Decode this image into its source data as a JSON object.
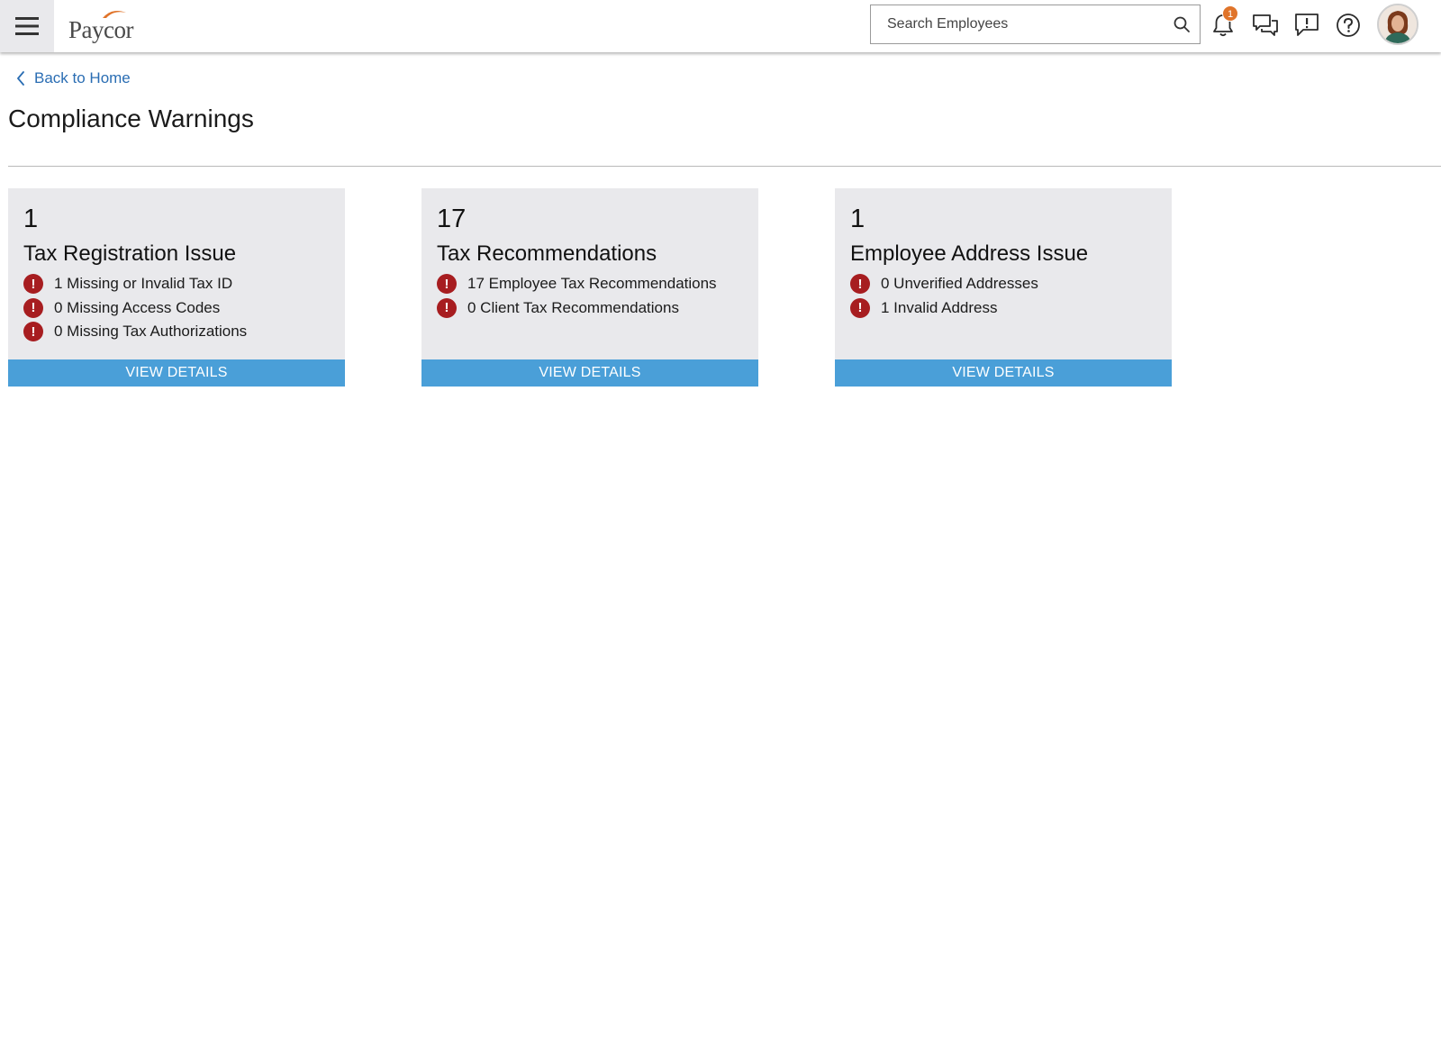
{
  "app": {
    "logo_text": "Paycor",
    "brand_color": "#e0742a",
    "accent_color": "#4a9fd8",
    "warning_color": "#a71d20"
  },
  "header": {
    "search_placeholder": "Search Employees",
    "notification_count": "1",
    "icons": [
      "menu-icon",
      "search-icon",
      "bell-icon",
      "chat-icon",
      "feedback-icon",
      "help-icon",
      "avatar"
    ]
  },
  "page": {
    "back_label": "Back to Home",
    "title": "Compliance Warnings"
  },
  "cards": [
    {
      "count": "1",
      "title": "Tax Registration Issue",
      "items": [
        "1 Missing or Invalid Tax ID",
        "0 Missing Access Codes",
        "0 Missing Tax Authorizations"
      ],
      "button_label": "VIEW DETAILS"
    },
    {
      "count": "17",
      "title": "Tax Recommendations",
      "items": [
        "17 Employee Tax Recommendations",
        "0 Client Tax Recommendations"
      ],
      "button_label": "VIEW DETAILS"
    },
    {
      "count": "1",
      "title": "Employee Address Issue",
      "items": [
        "0 Unverified Addresses",
        "1 Invalid Address"
      ],
      "button_label": "VIEW DETAILS"
    }
  ]
}
